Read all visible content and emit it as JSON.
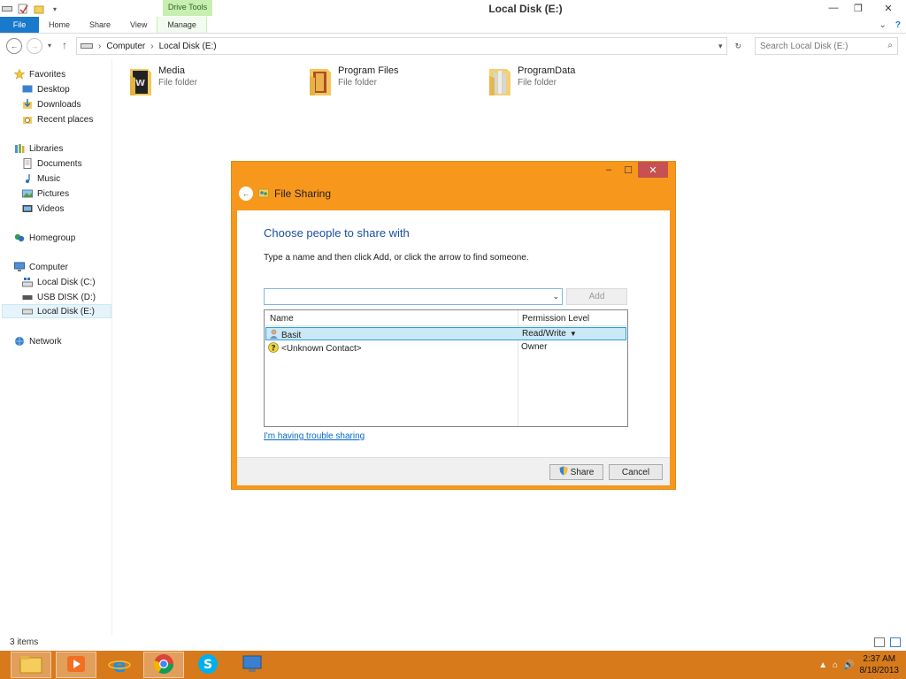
{
  "window": {
    "title": "Local Disk (E:)",
    "contextual_tab": "Drive Tools"
  },
  "ribbon": {
    "tabs": [
      "File",
      "Home",
      "Share",
      "View",
      "Manage"
    ]
  },
  "address": {
    "crumbs": [
      "Computer",
      "Local Disk (E:)"
    ],
    "search_placeholder": "Search Local Disk (E:)"
  },
  "nav": {
    "favorites": {
      "label": "Favorites",
      "items": [
        "Desktop",
        "Downloads",
        "Recent places"
      ]
    },
    "libraries": {
      "label": "Libraries",
      "items": [
        "Documents",
        "Music",
        "Pictures",
        "Videos"
      ]
    },
    "homegroup": "Homegroup",
    "computer": {
      "label": "Computer",
      "items": [
        "Local Disk (C:)",
        "USB DISK (D:)",
        "Local Disk (E:)"
      ]
    },
    "network": "Network"
  },
  "content": {
    "folders": [
      {
        "name": "Media",
        "type": "File folder"
      },
      {
        "name": "Program Files",
        "type": "File folder"
      },
      {
        "name": "ProgramData",
        "type": "File folder"
      }
    ]
  },
  "status": {
    "items": "3 items"
  },
  "dialog": {
    "title": "File Sharing",
    "heading": "Choose people to share with",
    "instruction": "Type a name and then click Add, or click the arrow to find someone.",
    "combo_value": "",
    "add_label": "Add",
    "columns": {
      "name": "Name",
      "permission": "Permission Level"
    },
    "rows": [
      {
        "name": "Basit",
        "permission": "Read/Write"
      },
      {
        "name": "<Unknown Contact>",
        "permission": "Owner"
      }
    ],
    "trouble_link": "I'm having trouble sharing",
    "share_label": "Share",
    "cancel_label": "Cancel"
  },
  "taskbar": {
    "time": "2:37 AM",
    "date": "8/18/2013"
  },
  "colors": {
    "taskbar": "#d77a1c",
    "dialog_frame": "#f7981d",
    "heading": "#1b4fa0",
    "file_tab": "#1979ca"
  }
}
